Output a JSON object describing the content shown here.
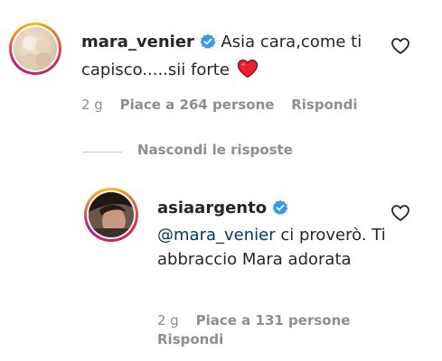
{
  "comments": [
    {
      "username": "mara_venier",
      "text": "Asia cara,come ti capisco.....sii forte",
      "emoji": "heart",
      "time": "2 g",
      "likes": "Piace a 264 persone",
      "reply": "Rispondi"
    },
    {
      "username": "asiaargento",
      "mention": "@mara_venier",
      "text": " ci proverò. Ti abbraccio Mara adorata",
      "time": "2 g",
      "likes": "Piace a 131 persone",
      "reply": "Rispondi"
    }
  ],
  "hide_replies": "Nascondi le risposte",
  "colors": {
    "verified": "#3897f0",
    "heart": "#ed4956",
    "meta": "#8e8e8e"
  }
}
